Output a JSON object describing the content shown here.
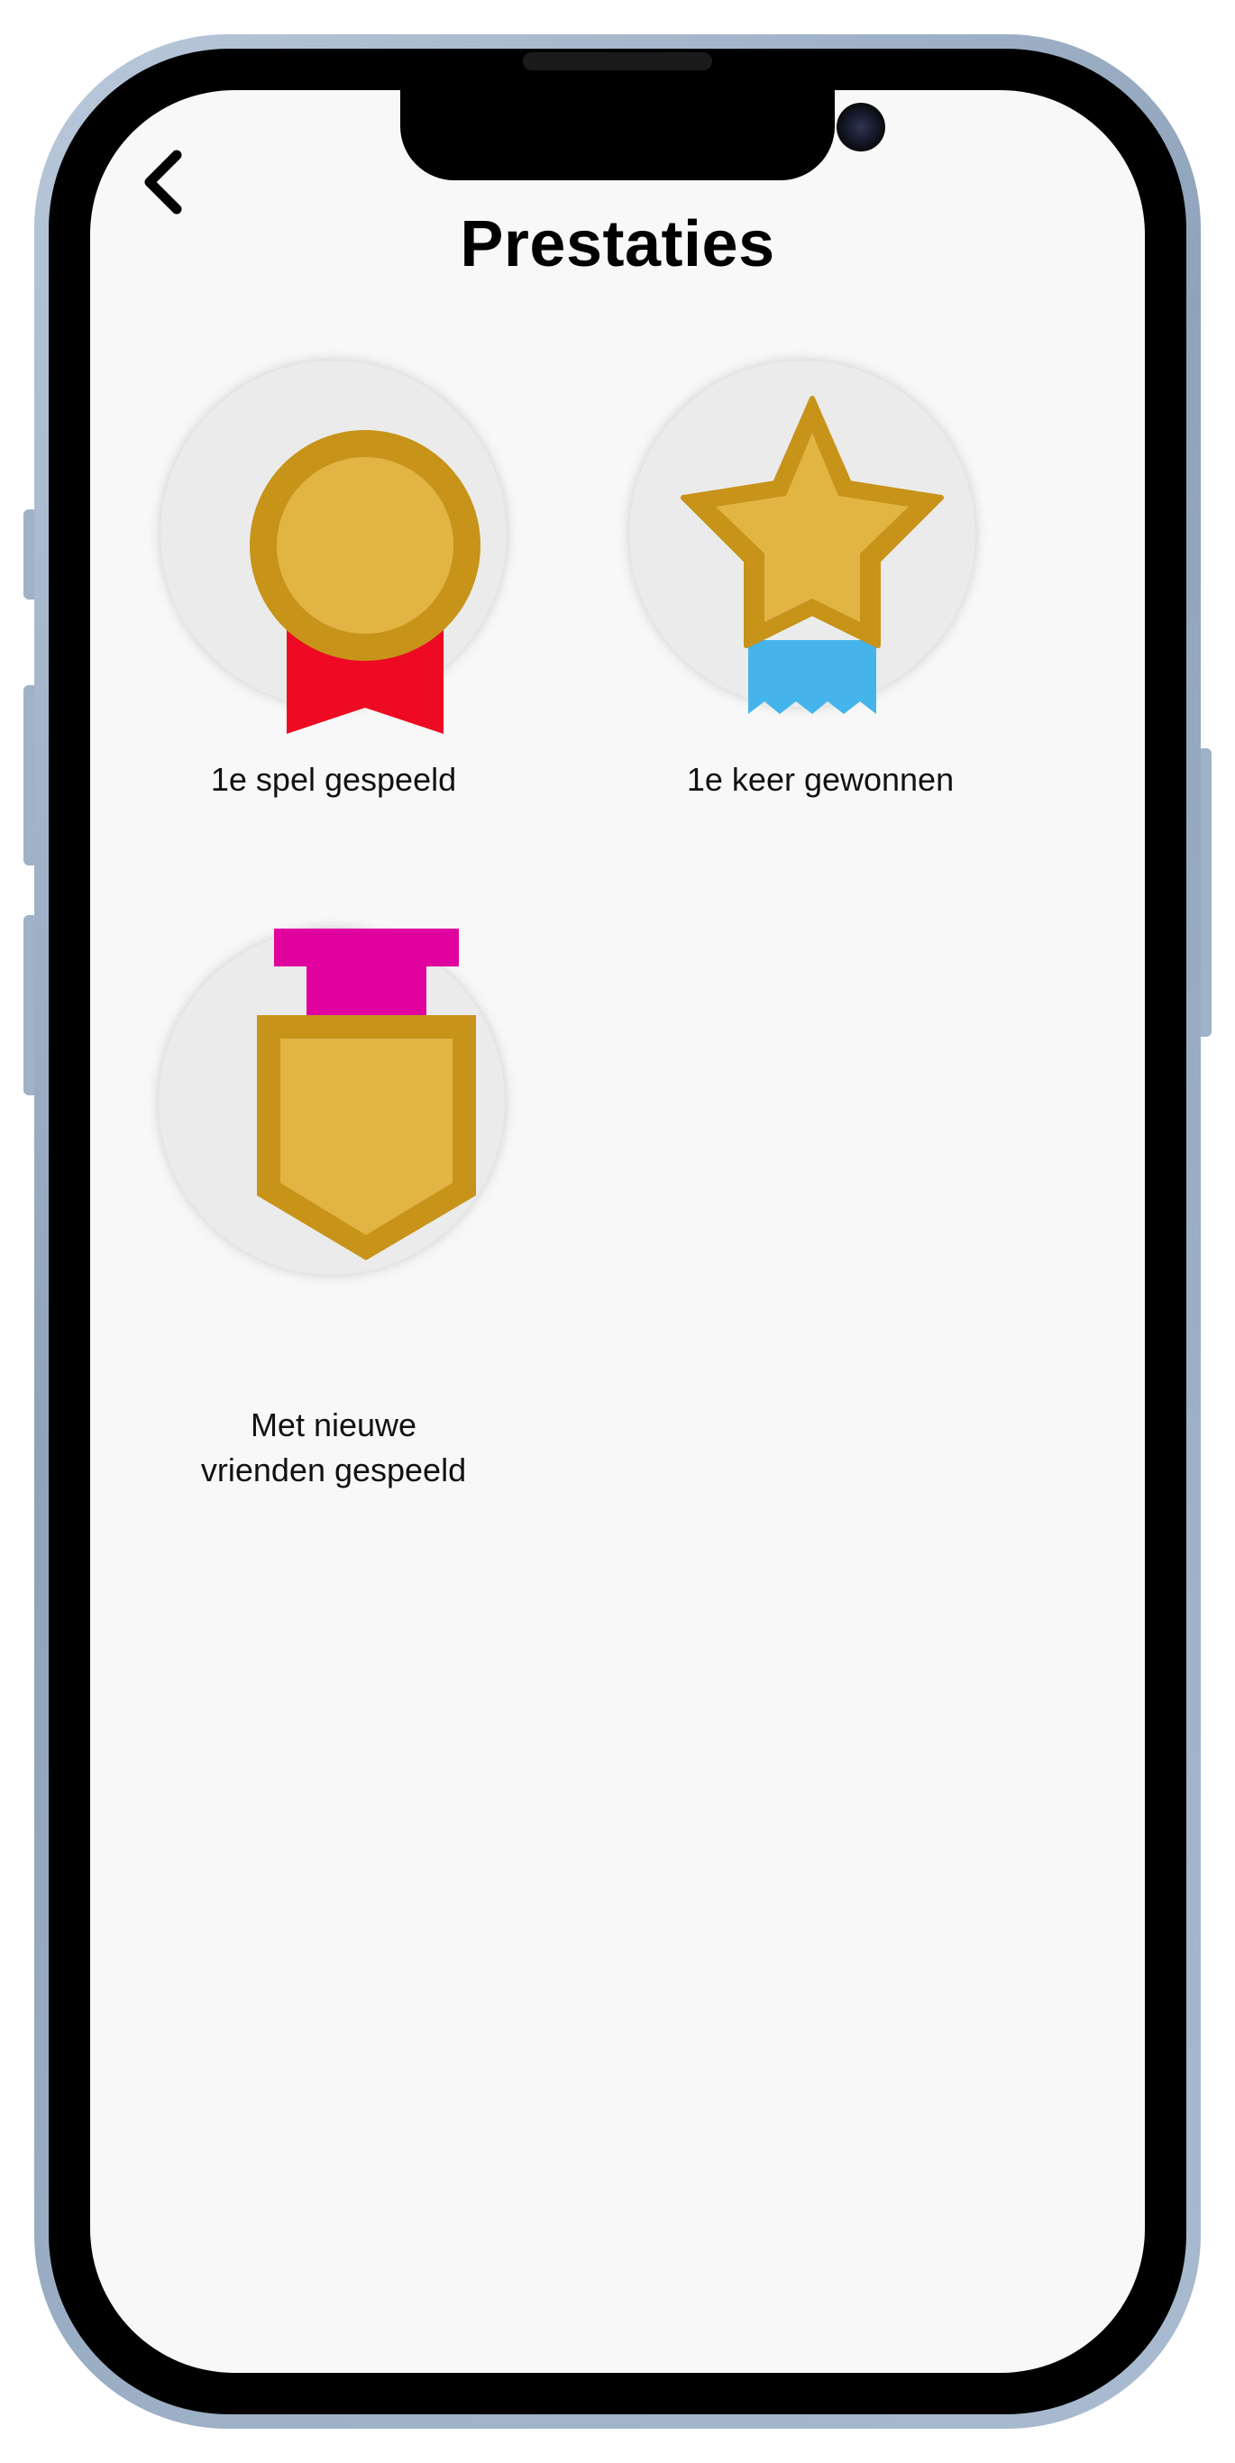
{
  "header": {
    "title": "Prestaties",
    "back_icon": "chevron-left-icon"
  },
  "achievements": [
    {
      "label": "1e spel gespeeld",
      "icon": "medal-ribbon-icon",
      "ribbon_color": "#ee0a22"
    },
    {
      "label": "1e keer gewonnen",
      "icon": "star-ribbon-icon",
      "ribbon_color": "#44b4ea"
    },
    {
      "label_line1": "Met nieuwe",
      "label_line2": "vrienden gespeeld",
      "icon": "shield-badge-icon",
      "ribbon_color": "#e0009e"
    }
  ],
  "colors": {
    "gold_fill": "#e2b444",
    "gold_stroke": "#c79319",
    "badge_background": "#ebebeb",
    "screen_background": "#f8f8f8"
  }
}
